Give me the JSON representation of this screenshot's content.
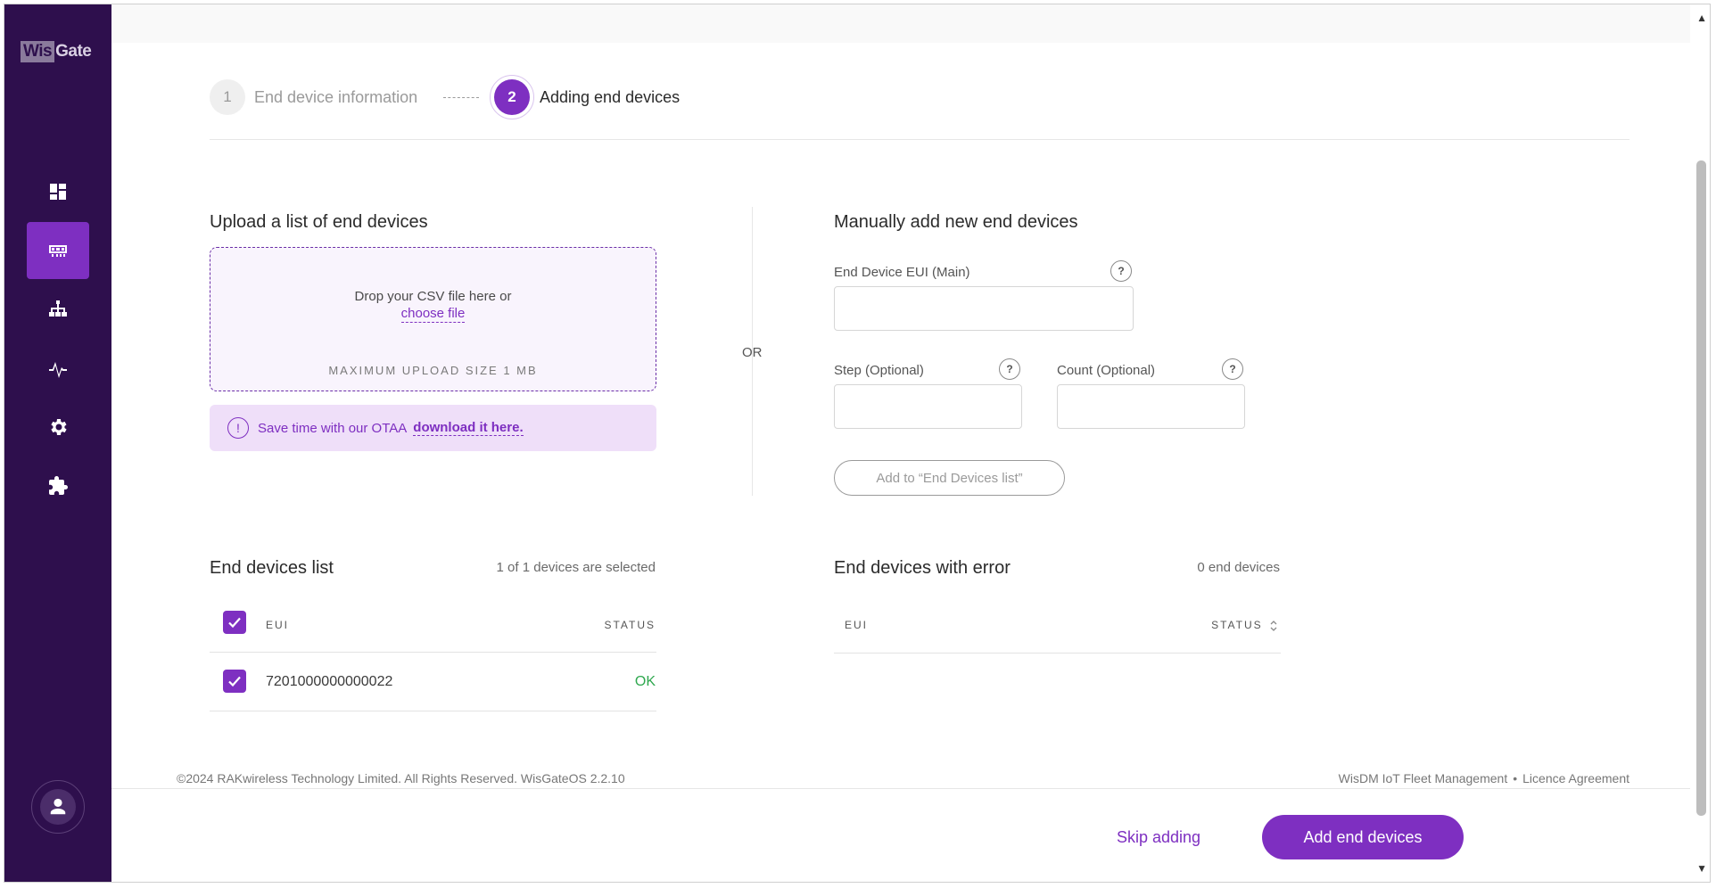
{
  "brand": {
    "logo_part1": "Wis",
    "logo_part2": "Gate"
  },
  "sidebar": {
    "items": [
      {
        "icon": "dashboard-icon"
      },
      {
        "icon": "end-devices-icon",
        "active": true
      },
      {
        "icon": "network-icon"
      },
      {
        "icon": "activity-icon"
      },
      {
        "icon": "settings-icon"
      },
      {
        "icon": "extensions-icon"
      }
    ],
    "user_icon": "user-icon"
  },
  "stepper": {
    "step1": {
      "number": "1",
      "label": "End device information"
    },
    "step2": {
      "number": "2",
      "label": "Adding end devices"
    }
  },
  "upload": {
    "title": "Upload a list of end devices",
    "drop_text": "Drop your CSV file here or",
    "choose_file": "choose file",
    "max_size": "MAXIMUM UPLOAD SIZE 1 MB",
    "otaa_text": "Save time with our OTAA",
    "otaa_link": "download it here."
  },
  "or_label": "OR",
  "manual": {
    "title": "Manually add new end devices",
    "eui_label": "End Device EUI (Main)",
    "eui_value": "",
    "step_label": "Step (Optional)",
    "step_value": "",
    "count_label": "Count (Optional)",
    "count_value": "",
    "help": "?",
    "add_button": "Add to “End Devices list”"
  },
  "end_devices_list": {
    "title": "End devices list",
    "meta": "1 of 1 devices are selected",
    "columns": {
      "eui": "EUI",
      "status": "STATUS"
    },
    "rows": [
      {
        "eui": "7201000000000022",
        "status": "OK",
        "selected": true
      }
    ]
  },
  "error_list": {
    "title": "End devices with error",
    "meta": "0 end devices",
    "columns": {
      "eui": "EUI",
      "status": "STATUS"
    }
  },
  "footer": {
    "copyright": "©2024 RAKwireless Technology Limited. All Rights Reserved. WisGateOS 2.2.10",
    "link1": "WisDM IoT Fleet Management",
    "separator": "•",
    "link2": "Licence Agreement"
  },
  "actions": {
    "skip": "Skip adding",
    "add": "Add end devices"
  },
  "colors": {
    "accent": "#7e2fc1",
    "sidebar": "#2e0f4d",
    "ok": "#2fa84f"
  }
}
